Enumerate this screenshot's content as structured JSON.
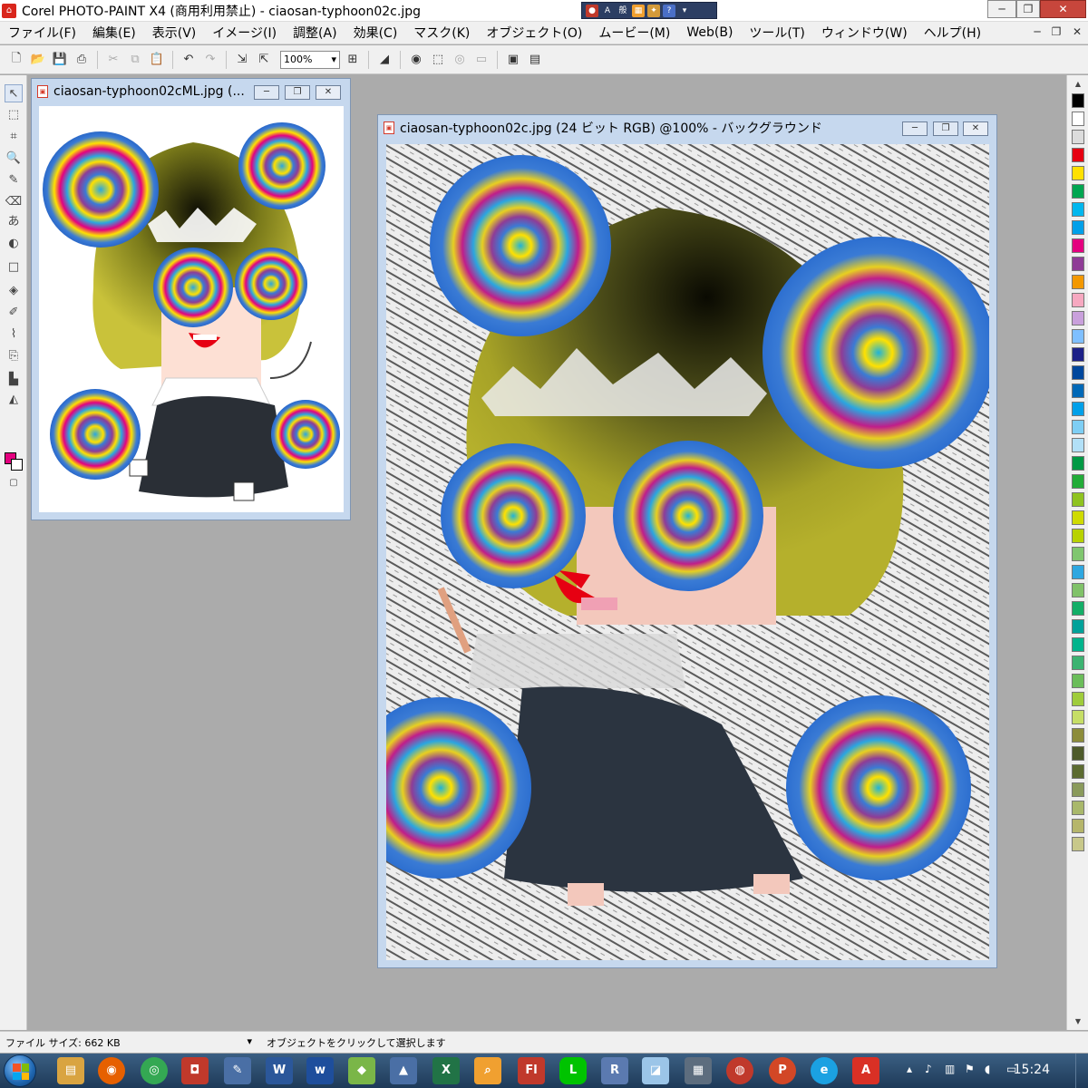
{
  "titlebar": {
    "app_title": "Corel PHOTO-PAINT X4 (商用利用禁止) - ciaosan-typhoon02c.jpg",
    "ime_label": "般"
  },
  "menu": {
    "items": [
      "ファイル(F)",
      "編集(E)",
      "表示(V)",
      "イメージ(I)",
      "調整(A)",
      "効果(C)",
      "マスク(K)",
      "オブジェクト(O)",
      "ムービー(M)",
      "Web(B)",
      "ツール(T)",
      "ウィンドウ(W)",
      "ヘルプ(H)"
    ]
  },
  "toolbar": {
    "zoom_value": "100%"
  },
  "doc_small": {
    "title": "ciaosan-typhoon02cML.jpg (..."
  },
  "doc_main": {
    "title": "ciaosan-typhoon02c.jpg (24 ビット RGB) @100% - バックグラウンド"
  },
  "colors": {
    "foreground": "#e4007f",
    "background": "#ffffff",
    "palette": [
      "#000000",
      "#ffffff",
      "#dcdcdc",
      "#e60012",
      "#ffe100",
      "#00a651",
      "#00b7ee",
      "#00a0e9",
      "#e4007f",
      "#8f3c96",
      "#f39800",
      "#f6a8c0",
      "#c9a0dc",
      "#7fbfff",
      "#1d2088",
      "#00479d",
      "#0068b7",
      "#00a0e9",
      "#7ecef4",
      "#b2e0f7",
      "#009944",
      "#22ac38",
      "#8fc31f",
      "#cfdb00",
      "#b8d200",
      "#7fc66f",
      "#2ea7e0",
      "#80c269",
      "#13ae67",
      "#00a29a",
      "#00b48c",
      "#3cb371",
      "#6bbd5a",
      "#9fcc3b",
      "#c6de66",
      "#8c8c3a",
      "#4d5a2a",
      "#5c6b30",
      "#8a9a5b",
      "#a9b86b",
      "#b6b66b",
      "#c8c88a"
    ]
  },
  "status": {
    "file_size": "ファイル サイズ: 662 KB",
    "message": "オブジェクトをクリックして選択します"
  },
  "taskbar": {
    "clock": "15:24",
    "icons": [
      "explorer",
      "firefox",
      "chrome",
      "camera",
      "paint",
      "word",
      "word-alt",
      "app",
      "inkscape",
      "excel",
      "search",
      "flash",
      "line",
      "r",
      "app2",
      "app3",
      "app4",
      "powerpoint",
      "ie",
      "acrobat"
    ]
  }
}
